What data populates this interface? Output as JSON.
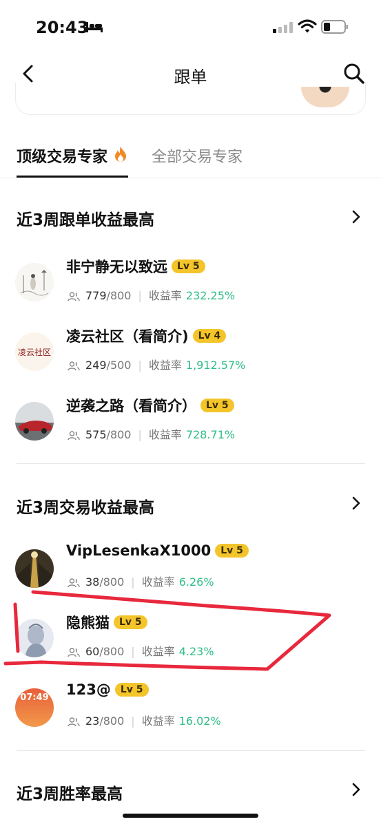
{
  "status_bar": {
    "time": "20:43"
  },
  "header": {
    "title": "跟单"
  },
  "tabs": [
    {
      "label": "顶级交易专家",
      "active": true
    },
    {
      "label": "全部交易专家",
      "active": false
    }
  ],
  "sections": [
    {
      "title": "近3周跟单收益最高",
      "rows": [
        {
          "name": "非宁静无以致远",
          "level": "Lv 5",
          "followers": "779",
          "capacity": "/800",
          "rate_label": "收益率",
          "rate": "232.25%"
        },
        {
          "name": "凌云社区（看简介)",
          "level": "Lv 4",
          "followers": "249",
          "capacity": "/500",
          "rate_label": "收益率",
          "rate": "1,912.57%",
          "avatar_text": "凌云社区"
        },
        {
          "name": "逆袭之路（看简介）",
          "level": "Lv 5",
          "followers": "575",
          "capacity": "/800",
          "rate_label": "收益率",
          "rate": "728.71%"
        }
      ]
    },
    {
      "title": "近3周交易收益最高",
      "rows": [
        {
          "name": "VipLesenkaX1000",
          "level": "Lv 5",
          "followers": "38",
          "capacity": "/800",
          "rate_label": "收益率",
          "rate": "6.26%"
        },
        {
          "name": "隐熊猫",
          "level": "Lv 5",
          "followers": "60",
          "capacity": "/800",
          "rate_label": "收益率",
          "rate": "4.23%"
        },
        {
          "name": "123@",
          "level": "Lv 5",
          "followers": "23",
          "capacity": "/800",
          "rate_label": "收益率",
          "rate": "16.02%",
          "avatar_text": "07:49"
        }
      ]
    },
    {
      "title": "近3周胜率最高"
    }
  ],
  "colors": {
    "accent_positive": "#2ebd85",
    "level_badge": "#f3c52b",
    "annotation": "#e8283c"
  }
}
